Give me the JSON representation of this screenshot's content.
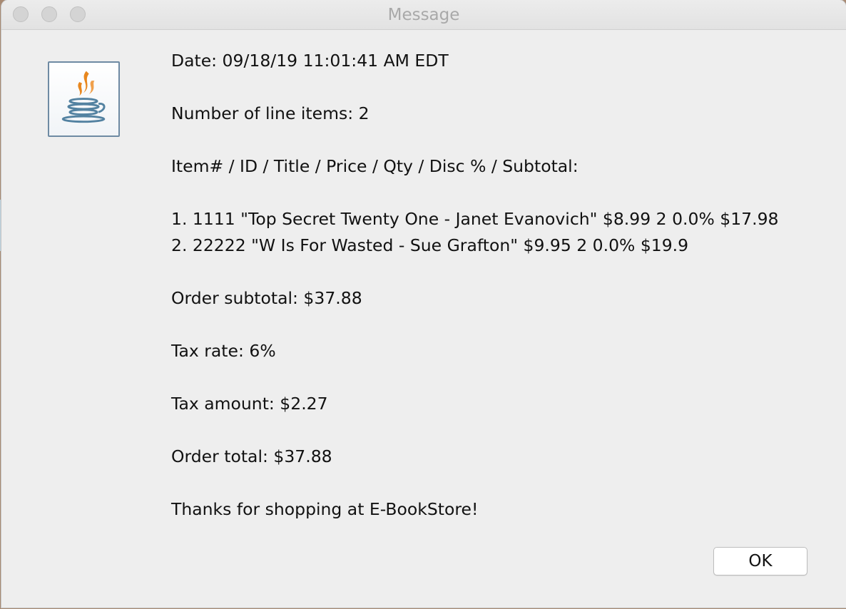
{
  "window": {
    "title": "Message"
  },
  "icon": {
    "name": "java-coffee-cup-icon"
  },
  "message": {
    "date_line": "Date: 09/18/19 11:01:41 AM EDT",
    "line_items_count_line": "Number of line items: 2",
    "columns_header_line": "Item# / ID / Title / Price / Qty / Disc % / Subtotal:",
    "line_items": [
      "1. 1111 \"Top Secret Twenty One - Janet Evanovich\" $8.99 2 0.0% $17.98",
      "2. 22222 \"W Is For Wasted - Sue Grafton\" $9.95 2 0.0% $19.9"
    ],
    "order_subtotal_line": "Order subtotal: $37.88",
    "tax_rate_line": "Tax rate: 6%",
    "tax_amount_line": "Tax amount: $2.27",
    "order_total_line": "Order total: $37.88",
    "thanks_line": "Thanks for shopping at E-BookStore!"
  },
  "buttons": {
    "ok_label": "OK"
  },
  "colors": {
    "window_background": "#eeeeee",
    "title_text": "#a9a9a9",
    "traffic_light_inactive": "#d4d4d4",
    "java_flame": "#e8871e",
    "java_cup": "#5382a1"
  }
}
